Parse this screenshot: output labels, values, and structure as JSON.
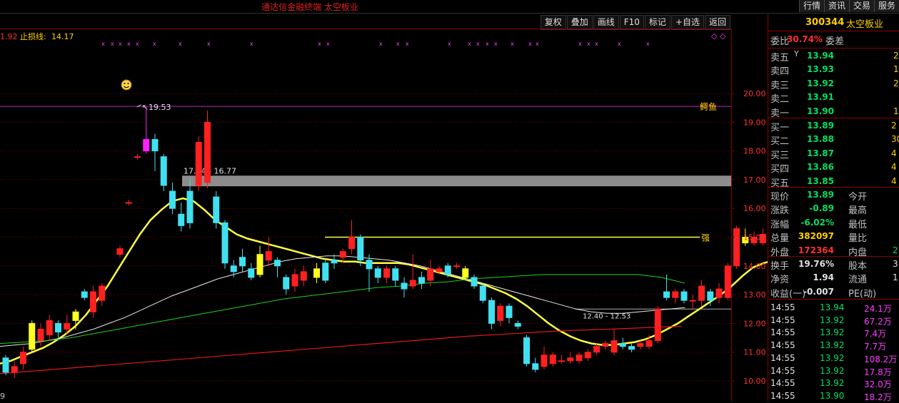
{
  "app": {
    "title": "通达信金融终端   太空板业"
  },
  "top_tabs": [
    "行情",
    "资讯",
    "交易",
    "服务"
  ],
  "toolbar": [
    "复权",
    "叠加",
    "画线",
    "F10",
    "标记",
    "+自选",
    "返回"
  ],
  "chart_header": {
    "left_fragment": "1.92",
    "stop_loss_label": "止损线:",
    "stop_loss_value": "14.17"
  },
  "chart_data": {
    "type": "candlestick",
    "y_axis": {
      "ticks": [
        10.0,
        11.0,
        12.0,
        13.0,
        14.0,
        15.0,
        16.0,
        17.0,
        18.0,
        19.0,
        20.0
      ],
      "tick_labels": [
        "10.00",
        "11.00",
        "12.00",
        "13.00",
        "14.00",
        "15.00",
        "16.00",
        "17.00",
        "18.00",
        "19.00",
        "20.00"
      ],
      "range": [
        9.3,
        21.0
      ]
    },
    "x_axis_fragment": "9",
    "candles": [
      {
        "o": 10.8,
        "c": 10.3,
        "h": 10.9,
        "l": 10.2
      },
      {
        "o": 10.3,
        "c": 10.5,
        "h": 10.7,
        "l": 10.1
      },
      {
        "o": 10.6,
        "c": 11.0,
        "h": 11.2,
        "l": 10.4
      },
      {
        "o": 11.1,
        "c": 12.0,
        "h": 12.1,
        "l": 11.0
      },
      {
        "o": 11.4,
        "c": 11.8,
        "h": 12.0,
        "l": 11.2
      },
      {
        "o": 11.6,
        "c": 12.1,
        "h": 12.3,
        "l": 11.4
      },
      {
        "o": 12.0,
        "c": 11.7,
        "h": 12.1,
        "l": 11.5
      },
      {
        "o": 11.8,
        "c": 12.0,
        "h": 12.3,
        "l": 11.6
      },
      {
        "o": 12.1,
        "c": 12.4,
        "h": 12.5,
        "l": 11.8
      },
      {
        "o": 13.1,
        "c": 12.9,
        "h": 13.2,
        "l": 12.8
      },
      {
        "o": 12.4,
        "c": 13.1,
        "h": 13.3,
        "l": 12.2
      },
      {
        "o": 12.8,
        "c": 13.3,
        "h": 13.4,
        "l": 12.6
      },
      {
        "o": 14.4,
        "c": 14.6,
        "h": 14.7,
        "l": 14.3
      },
      {
        "o": 16.2,
        "c": 16.2,
        "h": 16.3,
        "l": 16.1
      },
      {
        "o": 17.8,
        "c": 17.8,
        "h": 17.9,
        "l": 17.7
      },
      {
        "o": 18.0,
        "c": 18.4,
        "h": 19.53,
        "l": 17.9
      },
      {
        "o": 18.4,
        "c": 18.0,
        "h": 18.6,
        "l": 17.3
      },
      {
        "o": 17.8,
        "c": 16.8,
        "h": 17.9,
        "l": 16.6
      },
      {
        "o": 16.6,
        "c": 16.0,
        "h": 16.9,
        "l": 15.8
      },
      {
        "o": 15.8,
        "c": 15.4,
        "h": 16.2,
        "l": 15.2
      },
      {
        "o": 16.6,
        "c": 15.5,
        "h": 17.0,
        "l": 15.3
      },
      {
        "o": 16.8,
        "c": 18.3,
        "h": 18.5,
        "l": 16.6
      },
      {
        "o": 16.9,
        "c": 19.0,
        "h": 19.4,
        "l": 16.7
      },
      {
        "o": 16.4,
        "c": 15.5,
        "h": 16.6,
        "l": 15.3
      },
      {
        "o": 15.5,
        "c": 14.1,
        "h": 15.6,
        "l": 13.9
      },
      {
        "o": 14.0,
        "c": 13.8,
        "h": 14.2,
        "l": 13.6
      },
      {
        "o": 14.3,
        "c": 14.0,
        "h": 14.6,
        "l": 13.8
      },
      {
        "o": 13.9,
        "c": 13.6,
        "h": 14.1,
        "l": 13.5
      },
      {
        "o": 13.7,
        "c": 14.4,
        "h": 14.7,
        "l": 13.6
      },
      {
        "o": 14.2,
        "c": 14.5,
        "h": 15.0,
        "l": 14.0
      },
      {
        "o": 14.2,
        "c": 14.0,
        "h": 14.3,
        "l": 13.6
      },
      {
        "o": 13.6,
        "c": 13.2,
        "h": 13.7,
        "l": 13.0
      },
      {
        "o": 13.3,
        "c": 13.7,
        "h": 13.9,
        "l": 13.1
      },
      {
        "o": 13.5,
        "c": 13.8,
        "h": 14.0,
        "l": 13.3
      },
      {
        "o": 13.9,
        "c": 13.6,
        "h": 14.1,
        "l": 13.4
      },
      {
        "o": 14.1,
        "c": 13.5,
        "h": 14.2,
        "l": 13.4
      },
      {
        "o": 14.2,
        "c": 14.1,
        "h": 14.4,
        "l": 13.9
      },
      {
        "o": 14.3,
        "c": 14.5,
        "h": 14.6,
        "l": 14.1
      },
      {
        "o": 14.6,
        "c": 15.0,
        "h": 15.6,
        "l": 14.4
      },
      {
        "o": 15.0,
        "c": 14.2,
        "h": 15.1,
        "l": 14.0
      },
      {
        "o": 14.2,
        "c": 13.9,
        "h": 14.4,
        "l": 13.1
      },
      {
        "o": 13.9,
        "c": 13.6,
        "h": 14.0,
        "l": 13.4
      },
      {
        "o": 13.6,
        "c": 13.9,
        "h": 14.0,
        "l": 13.4
      },
      {
        "o": 13.9,
        "c": 13.5,
        "h": 14.0,
        "l": 13.3
      },
      {
        "o": 13.4,
        "c": 13.2,
        "h": 13.6,
        "l": 12.9
      },
      {
        "o": 13.3,
        "c": 13.5,
        "h": 14.4,
        "l": 13.2
      },
      {
        "o": 13.6,
        "c": 13.4,
        "h": 13.8,
        "l": 13.2
      },
      {
        "o": 13.5,
        "c": 13.9,
        "h": 14.2,
        "l": 13.3
      },
      {
        "o": 13.8,
        "c": 13.9,
        "h": 14.0,
        "l": 13.7
      },
      {
        "o": 14.0,
        "c": 13.7,
        "h": 14.1,
        "l": 13.6
      },
      {
        "o": 14.0,
        "c": 14.0,
        "h": 14.1,
        "l": 13.9
      },
      {
        "o": 13.9,
        "c": 13.6,
        "h": 14.0,
        "l": 13.5
      },
      {
        "o": 13.6,
        "c": 13.3,
        "h": 13.7,
        "l": 13.2
      },
      {
        "o": 13.3,
        "c": 12.8,
        "h": 13.4,
        "l": 12.7
      },
      {
        "o": 12.8,
        "c": 12.0,
        "h": 12.9,
        "l": 11.8
      },
      {
        "o": 12.1,
        "c": 12.6,
        "h": 12.7,
        "l": 11.9
      },
      {
        "o": 12.6,
        "c": 12.2,
        "h": 12.7,
        "l": 12.0
      },
      {
        "o": 12.0,
        "c": 11.9,
        "h": 12.1,
        "l": 11.8
      },
      {
        "o": 11.5,
        "c": 10.6,
        "h": 11.6,
        "l": 10.5
      },
      {
        "o": 10.6,
        "c": 10.4,
        "h": 10.8,
        "l": 10.3
      },
      {
        "o": 10.5,
        "c": 10.9,
        "h": 11.2,
        "l": 10.4
      },
      {
        "o": 10.6,
        "c": 10.9,
        "h": 11.0,
        "l": 10.5
      },
      {
        "o": 10.7,
        "c": 10.7,
        "h": 10.9,
        "l": 10.6
      },
      {
        "o": 10.7,
        "c": 10.8,
        "h": 11.0,
        "l": 10.6
      },
      {
        "o": 10.7,
        "c": 10.9,
        "h": 11.0,
        "l": 10.6
      },
      {
        "o": 10.8,
        "c": 11.0,
        "h": 11.1,
        "l": 10.7
      },
      {
        "o": 11.0,
        "c": 11.2,
        "h": 11.3,
        "l": 10.9
      },
      {
        "o": 11.2,
        "c": 11.3,
        "h": 11.4,
        "l": 11.1
      },
      {
        "o": 11.0,
        "c": 11.4,
        "h": 11.8,
        "l": 10.9
      },
      {
        "o": 11.3,
        "c": 11.2,
        "h": 11.5,
        "l": 11.1
      },
      {
        "o": 11.2,
        "c": 11.1,
        "h": 11.3,
        "l": 11.0
      },
      {
        "o": 11.2,
        "c": 11.3,
        "h": 11.4,
        "l": 11.1
      },
      {
        "o": 11.2,
        "c": 11.4,
        "h": 11.6,
        "l": 11.1
      },
      {
        "o": 11.4,
        "c": 12.5,
        "h": 12.6,
        "l": 11.3
      },
      {
        "o": 13.1,
        "c": 12.9,
        "h": 13.7,
        "l": 12.8
      },
      {
        "o": 12.9,
        "c": 13.1,
        "h": 13.2,
        "l": 12.7
      },
      {
        "o": 13.1,
        "c": 12.8,
        "h": 13.2,
        "l": 12.7
      },
      {
        "o": 12.8,
        "c": 12.8,
        "h": 13.0,
        "l": 12.5
      },
      {
        "o": 12.8,
        "c": 13.3,
        "h": 13.5,
        "l": 12.6
      },
      {
        "o": 13.1,
        "c": 12.8,
        "h": 13.2,
        "l": 12.6
      },
      {
        "o": 12.9,
        "c": 13.2,
        "h": 13.4,
        "l": 12.7
      },
      {
        "o": 12.9,
        "c": 14.0,
        "h": 14.1,
        "l": 12.8
      },
      {
        "o": 14.0,
        "c": 15.3,
        "h": 15.4,
        "l": 13.9
      },
      {
        "o": 15.0,
        "c": 14.8,
        "h": 15.3,
        "l": 14.7
      },
      {
        "o": 14.8,
        "c": 15.0,
        "h": 15.2,
        "l": 14.7
      },
      {
        "o": 14.8,
        "c": 15.1,
        "h": 15.3,
        "l": 14.7
      },
      {
        "o": 15.0,
        "c": 14.7,
        "h": 16.0,
        "l": 14.6
      },
      {
        "o": 14.8,
        "c": 14.8,
        "h": 14.9,
        "l": 14.7
      },
      {
        "o": 14.8,
        "c": 13.9,
        "h": 14.9,
        "l": 13.8
      }
    ],
    "series": [
      {
        "name": "MA5",
        "color": "#ffff40",
        "values": [
          10.6,
          10.7,
          10.85,
          11.0,
          11.15,
          11.35,
          11.6,
          11.9,
          12.3,
          12.8,
          13.3,
          13.9,
          14.5,
          15.1,
          15.6,
          15.95,
          16.25,
          16.35,
          16.25,
          15.95,
          15.6,
          15.35,
          15.1,
          14.95,
          14.85,
          14.75,
          14.65,
          14.55,
          14.45,
          14.35,
          14.25,
          14.2,
          14.15,
          14.15,
          14.1,
          14.1,
          14.1,
          14.1,
          14.05,
          13.95,
          13.85,
          13.75,
          13.65,
          13.55,
          13.45,
          13.35,
          13.2,
          13.05,
          12.85,
          12.6,
          12.3,
          12.0,
          11.75,
          11.55,
          11.4,
          11.3,
          11.25,
          11.25,
          11.3,
          11.35,
          11.45,
          11.6,
          11.8,
          12.0,
          12.25,
          12.5,
          12.75,
          13.0,
          13.3,
          13.65,
          13.95,
          14.1,
          14.2
        ]
      },
      {
        "name": "MA20",
        "color": "#e8e8e8",
        "values": [
          11.2,
          11.25,
          11.3,
          11.4,
          11.5,
          11.65,
          11.8,
          12.0,
          12.2,
          12.45,
          12.7,
          12.95,
          13.15,
          13.35,
          13.55,
          13.7,
          13.85,
          14.0,
          14.15,
          14.25,
          14.3,
          14.35,
          14.35,
          14.3,
          14.25,
          14.2,
          14.1,
          14.0,
          13.85,
          13.7,
          13.55,
          13.4,
          13.25,
          13.1,
          12.95,
          12.8,
          12.65,
          12.5,
          12.4,
          12.35,
          12.35,
          12.4,
          12.45,
          12.5,
          12.55
        ]
      },
      {
        "name": "MA60",
        "color": "#20d020",
        "values": [
          11.3,
          11.35,
          11.4,
          11.5,
          11.65,
          11.8,
          11.95,
          12.1,
          12.25,
          12.4,
          12.55,
          12.7,
          12.85,
          12.95,
          13.05,
          13.15,
          13.25,
          13.3,
          13.4,
          13.45,
          13.55,
          13.6,
          13.65,
          13.7,
          13.7,
          13.7,
          13.7,
          13.7,
          13.6,
          13.4
        ]
      },
      {
        "name": "MA120",
        "color": "#e01818",
        "values": [
          10.25,
          10.35,
          10.45,
          10.55,
          10.65,
          10.75,
          10.85,
          10.95,
          11.05,
          11.15,
          11.25,
          11.35,
          11.45,
          11.55,
          11.62,
          11.7,
          11.76,
          11.8,
          11.85,
          11.9
        ]
      }
    ],
    "markers": [
      "x",
      "x",
      "x",
      "x",
      "x",
      "x",
      "x",
      "x",
      "x",
      "x",
      "x",
      "x",
      "x",
      "x",
      "x",
      "x",
      "x",
      "x",
      "x",
      "x",
      "x",
      "x",
      "x",
      "x",
      "x",
      "x",
      "x"
    ],
    "annotations": {
      "high_label": "19.53",
      "box_label": "17.14 - 16.77",
      "box_range": [
        16.77,
        17.14
      ],
      "low_box_label": "12.40 - 12.53",
      "resistance": 15.0,
      "magenta_line": 19.55,
      "magenta_line_label": "鳄鱼",
      "strong_label": "强",
      "diamond_glyphs": "◇ ◇"
    }
  },
  "quote": {
    "code": "300344",
    "name": "太空板业",
    "weibi_label": "委比",
    "weibi_value": "30.74%",
    "weicha_label": "委差",
    "asks": [
      {
        "label": "卖五",
        "price": "13.94",
        "vol": "2"
      },
      {
        "label": "卖四",
        "price": "13.93",
        "vol": "1"
      },
      {
        "label": "卖三",
        "price": "13.92",
        "vol": "2"
      },
      {
        "label": "卖二",
        "price": "13.91",
        "vol": ""
      },
      {
        "label": "卖一",
        "price": "13.90",
        "vol": "17"
      }
    ],
    "ask5_glyph": "Y",
    "bids": [
      {
        "label": "买一",
        "price": "13.89",
        "vol": "2"
      },
      {
        "label": "买二",
        "price": "13.88",
        "vol": "30"
      },
      {
        "label": "买三",
        "price": "13.87",
        "vol": "4"
      },
      {
        "label": "买四",
        "price": "13.86",
        "vol": "4"
      },
      {
        "label": "买五",
        "price": "13.85",
        "vol": "4"
      }
    ],
    "stats": [
      {
        "label": "现价",
        "value": "13.89",
        "label2": "今开",
        "cls": "green"
      },
      {
        "label": "涨跌",
        "value": "-0.89",
        "label2": "最高",
        "cls": "green"
      },
      {
        "label": "涨幅",
        "value": "-6.02%",
        "label2": "最低",
        "cls": "green"
      },
      {
        "label": "总量",
        "value": "382097",
        "label2": "量比",
        "cls": "yellow"
      },
      {
        "label": "外盘",
        "value": "172364",
        "label2": "内盘",
        "cls": "red",
        "extra": "2"
      }
    ],
    "stats2": [
      {
        "label": "换手",
        "value": "19.76%",
        "label2": "股本",
        "extra": "3"
      },
      {
        "label": "净资",
        "value": "1.94",
        "label2": "流通",
        "extra": "1"
      },
      {
        "label": "收益(一)",
        "value": "-0.007",
        "label2": "PE(动)",
        "extra": ""
      }
    ],
    "ticks": [
      {
        "time": "14:55",
        "price": "13.94",
        "vol": "24.1万"
      },
      {
        "time": "14:55",
        "price": "13.92",
        "vol": "67.2万"
      },
      {
        "time": "14:55",
        "price": "13.92",
        "vol": "7.4万"
      },
      {
        "time": "14:55",
        "price": "13.92",
        "vol": "7.7万"
      },
      {
        "time": "14:55",
        "price": "13.92",
        "vol": "108.2万"
      },
      {
        "time": "14:55",
        "price": "13.92",
        "vol": "17.8万"
      },
      {
        "time": "14:55",
        "price": "13.92",
        "vol": "32.0万"
      },
      {
        "time": "14:55",
        "price": "13.90",
        "vol": "18.2万"
      }
    ]
  }
}
